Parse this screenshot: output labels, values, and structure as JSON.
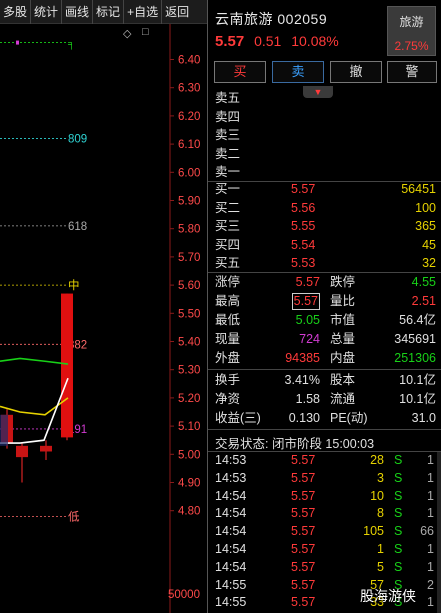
{
  "toolbar": {
    "items": [
      "多股",
      "统计",
      "画线",
      "标记",
      "+自选",
      "返回"
    ]
  },
  "chart": {
    "price_labels": [
      "6.40",
      "6.30",
      "6.20",
      "6.10",
      "6.00",
      "5.90",
      "5.80",
      "5.70",
      "5.60",
      "5.50",
      "5.40",
      "5.30",
      "5.20",
      "5.10",
      "5.00",
      "4.90",
      "4.80"
    ],
    "volume_label": "50000",
    "fib_labels": [
      "809",
      "618",
      "中",
      "382",
      "191",
      "低"
    ],
    "fib_colors": [
      "#2fd3d3",
      "#aaaaaa",
      "#e6d200",
      "#ff6a6a",
      "#d23bd2",
      "#ff6a6a"
    ],
    "fib_values": [
      6.12,
      5.81,
      5.6,
      5.39,
      5.09,
      4.78
    ],
    "top_marker_value": 6.46,
    "moving_average_colors": [
      "#18d118",
      "#e6d200",
      "#ffffff"
    ],
    "corner_icons": [
      "diamond-icon",
      "square-icon"
    ]
  },
  "stock": {
    "name_code": "云南旅游 002059",
    "price": "5.57",
    "change": "0.51",
    "change_pct": "10.08%",
    "sector_name": "旅游",
    "sector_pct": "2.75%"
  },
  "trade_buttons": [
    "买",
    "卖",
    "撤",
    "警"
  ],
  "expand_icon": "chevron-down-icon",
  "sell_levels": [
    {
      "label": "卖五",
      "price": "",
      "vol": ""
    },
    {
      "label": "卖四",
      "price": "",
      "vol": ""
    },
    {
      "label": "卖三",
      "price": "",
      "vol": ""
    },
    {
      "label": "卖二",
      "price": "",
      "vol": ""
    },
    {
      "label": "卖一",
      "price": "",
      "vol": ""
    }
  ],
  "buy_levels": [
    {
      "label": "买一",
      "price": "5.57",
      "vol": "56451"
    },
    {
      "label": "买二",
      "price": "5.56",
      "vol": "100"
    },
    {
      "label": "买三",
      "price": "5.55",
      "vol": "365"
    },
    {
      "label": "买四",
      "price": "5.54",
      "vol": "45"
    },
    {
      "label": "买五",
      "price": "5.53",
      "vol": "32"
    }
  ],
  "stats": [
    {
      "l1": "涨停",
      "v1": "5.57",
      "c1": "red",
      "l2": "跌停",
      "v2": "4.55",
      "c2": "green"
    },
    {
      "l1": "最高",
      "v1": "5.57",
      "c1": "red",
      "l2": "量比",
      "v2": "2.51",
      "c2": "red"
    },
    {
      "l1": "最低",
      "v1": "5.05",
      "c1": "green",
      "l2": "市值",
      "v2": "56.4亿",
      "c2": "white"
    },
    {
      "l1": "现量",
      "v1": "724",
      "c1": "purple",
      "l2": "总量",
      "v2": "345691",
      "c2": "white"
    },
    {
      "l1": "外盘",
      "v1": "94385",
      "c1": "red",
      "l2": "内盘",
      "v2": "251306",
      "c2": "green"
    }
  ],
  "stats2": [
    {
      "l1": "换手",
      "v1": "3.41%",
      "l2": "股本",
      "v2": "10.1亿"
    },
    {
      "l1": "净资",
      "v1": "1.58",
      "l2": "流通",
      "v2": "10.1亿"
    },
    {
      "l1": "收益(三)",
      "v1": "0.130",
      "l2": "PE(动)",
      "v2": "31.0"
    }
  ],
  "trade_status": "交易状态: 闭市阶段 15:00:03",
  "ticks": [
    {
      "time": "14:53",
      "price": "5.57",
      "vol": "28",
      "side": "S",
      "n": "1"
    },
    {
      "time": "14:53",
      "price": "5.57",
      "vol": "3",
      "side": "S",
      "n": "1"
    },
    {
      "time": "14:54",
      "price": "5.57",
      "vol": "10",
      "side": "S",
      "n": "1"
    },
    {
      "time": "14:54",
      "price": "5.57",
      "vol": "8",
      "side": "S",
      "n": "1"
    },
    {
      "time": "14:54",
      "price": "5.57",
      "vol": "105",
      "side": "S",
      "n": "66"
    },
    {
      "time": "14:54",
      "price": "5.57",
      "vol": "1",
      "side": "S",
      "n": "1"
    },
    {
      "time": "14:54",
      "price": "5.57",
      "vol": "5",
      "side": "S",
      "n": "1"
    },
    {
      "time": "14:55",
      "price": "5.57",
      "vol": "57",
      "side": "S",
      "n": "2"
    },
    {
      "time": "14:55",
      "price": "5.57",
      "vol": "33",
      "side": "S",
      "n": "1"
    }
  ],
  "watermark": "股海游侠"
}
